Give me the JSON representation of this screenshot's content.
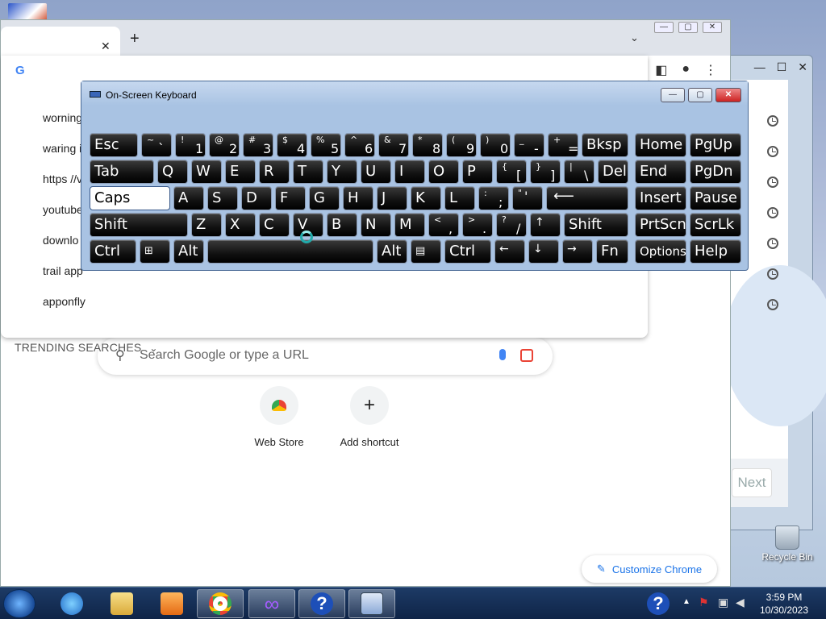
{
  "chrome": {
    "suggestions": [
      "worning",
      "waring i",
      "https //v",
      "youtube",
      "downlo",
      "trail app",
      "apponfly"
    ],
    "trending_label": "TRENDING SEARCHES",
    "search_placeholder": "Search Google or type a URL",
    "shortcuts": [
      {
        "label": "Web Store"
      },
      {
        "label": "Add shortcut"
      }
    ],
    "customize_label": "Customize Chrome"
  },
  "background_window": {
    "next_label": "Next"
  },
  "osk": {
    "title": "On-Screen Keyboard",
    "keys": {
      "esc": "Esc",
      "bksp": "Bksp",
      "home": "Home",
      "pgup": "PgUp",
      "tab": "Tab",
      "del": "Del",
      "end": "End",
      "pgdn": "PgDn",
      "caps": "Caps",
      "insert": "Insert",
      "pause": "Pause",
      "shift": "Shift",
      "prtscn": "PrtScn",
      "scrlk": "ScrLk",
      "ctrl": "Ctrl",
      "alt": "Alt",
      "fn": "Fn",
      "options": "Options",
      "help": "Help",
      "q": "Q",
      "w": "W",
      "e": "E",
      "r": "R",
      "t": "T",
      "y": "Y",
      "u": "U",
      "i": "I",
      "o": "O",
      "p": "P",
      "a": "A",
      "s": "S",
      "d": "D",
      "f": "F",
      "g": "G",
      "h": "H",
      "j": "J",
      "k": "K",
      "l": "L",
      "z": "Z",
      "x": "X",
      "c": "C",
      "v": "V",
      "b": "B",
      "n": "N",
      "m": "M"
    },
    "number_row": [
      {
        "up": "~",
        "low": "`"
      },
      {
        "up": "!",
        "low": "1"
      },
      {
        "up": "@",
        "low": "2"
      },
      {
        "up": "#",
        "low": "3"
      },
      {
        "up": "$",
        "low": "4"
      },
      {
        "up": "%",
        "low": "5"
      },
      {
        "up": "^",
        "low": "6"
      },
      {
        "up": "&",
        "low": "7"
      },
      {
        "up": "*",
        "low": "8"
      },
      {
        "up": "(",
        "low": "9"
      },
      {
        "up": ")",
        "low": "0"
      },
      {
        "up": "_",
        "low": "-"
      },
      {
        "up": "+",
        "low": "="
      }
    ],
    "bracket_keys": [
      {
        "up": "{",
        "low": "["
      },
      {
        "up": "}",
        "low": "]"
      },
      {
        "up": "|",
        "low": "\\"
      }
    ],
    "semi_keys": [
      {
        "up": ":",
        "low": ";"
      },
      {
        "up": "\"",
        "low": "'"
      }
    ],
    "punct_keys": [
      {
        "up": "<",
        "low": ","
      },
      {
        "up": ">",
        "low": "."
      },
      {
        "up": "?",
        "low": "/"
      }
    ],
    "arrows": {
      "up": "↑",
      "left": "←",
      "down": "↓",
      "right": "→",
      "enter": "⟵"
    }
  },
  "desktop": {
    "recycle_bin_label": "Recycle Bin"
  },
  "taskbar": {
    "time": "3:59 PM",
    "date": "10/30/2023"
  }
}
